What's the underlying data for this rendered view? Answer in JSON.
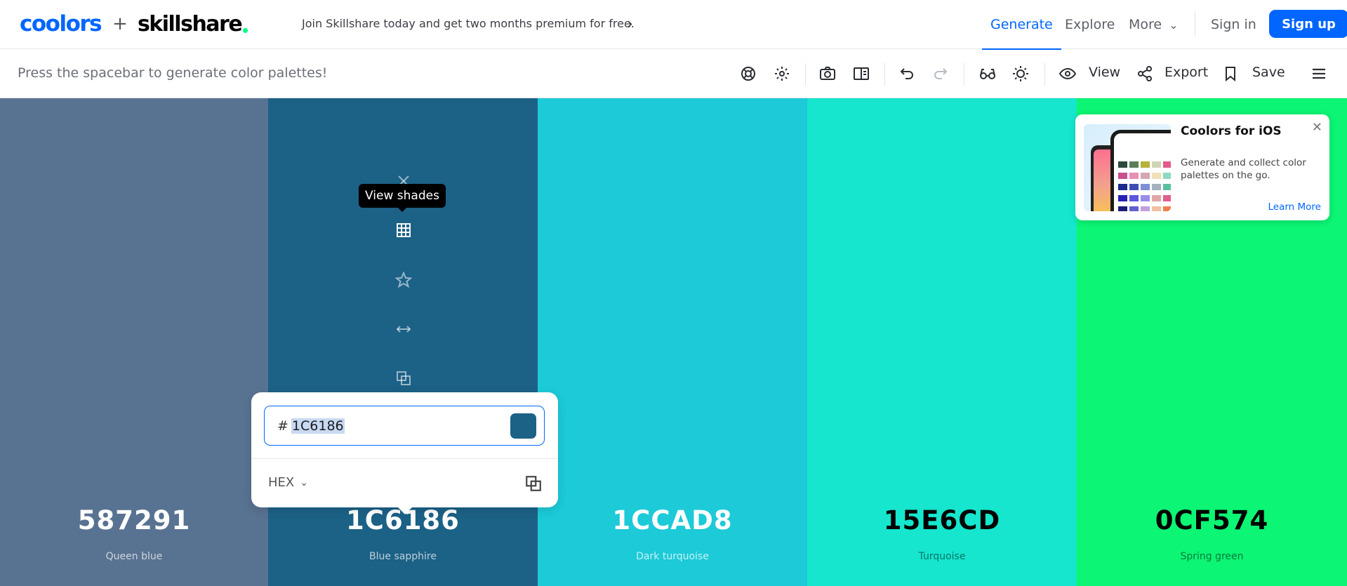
{
  "header": {
    "brand_left": "coolors",
    "plus": "+",
    "brand_right": "skillshare",
    "promo": "Join Skillshare today and get two months premium for free.",
    "nav": {
      "generate": "Generate",
      "explore": "Explore",
      "more": "More",
      "signin": "Sign in",
      "signup": "Sign up"
    }
  },
  "toolbar": {
    "hint": "Press the spacebar to generate color palettes!",
    "view_label": "View",
    "export_label": "Export",
    "save_label": "Save"
  },
  "palette": [
    {
      "hex": "587291",
      "name": "Queen blue",
      "color": "#587291",
      "text_color": "#ffffff",
      "sub_color": "rgba(255,255,255,0.7)"
    },
    {
      "hex": "1C6186",
      "name": "Blue sapphire",
      "color": "#1c6186",
      "text_color": "#ffffff",
      "sub_color": "rgba(255,255,255,0.7)"
    },
    {
      "hex": "1CCAD8",
      "name": "Dark turquoise",
      "color": "#1ccad8",
      "text_color": "#ffffff",
      "sub_color": "rgba(255,255,255,0.75)"
    },
    {
      "hex": "15E6CD",
      "name": "Turquoise",
      "color": "#15e6cd",
      "text_color": "#000000",
      "sub_color": "rgba(0,0,0,0.5)"
    },
    {
      "hex": "0CF574",
      "name": "Spring green",
      "color": "#0cf574",
      "text_color": "#000000",
      "sub_color": "rgba(0,0,0,0.5)"
    }
  ],
  "tooltip": "View shades",
  "picker": {
    "prefix": "#",
    "value": "1C6186",
    "mode": "HEX",
    "chip_color": "#1c6186"
  },
  "ad": {
    "title": "Coolors for iOS",
    "text": "Generate and collect color palettes on the go.",
    "link": "Learn More"
  },
  "colors": {
    "accent": "#0066ff"
  },
  "icons": [
    "lifebuoy-icon",
    "gear-icon",
    "camera-icon",
    "split-view-icon",
    "undo-icon",
    "redo-icon",
    "glasses-icon",
    "sun-icon",
    "eye-icon",
    "share-icon",
    "bookmark-icon",
    "menu-icon",
    "close-icon",
    "grid-icon",
    "star-icon",
    "drag-icon",
    "copy-icon",
    "chevron-right-icon",
    "chevron-down-icon"
  ]
}
